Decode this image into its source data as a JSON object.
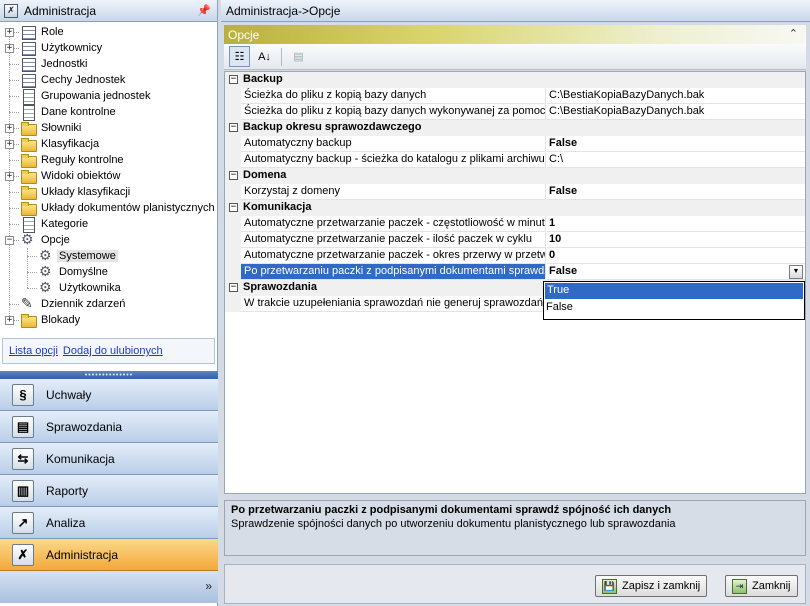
{
  "left_header": {
    "title": "Administracja"
  },
  "tree": [
    {
      "label": "Role",
      "icon": "grid-icon",
      "expander": "+"
    },
    {
      "label": "Użytkownicy",
      "icon": "grid-icon",
      "expander": "+"
    },
    {
      "label": "Jednostki",
      "icon": "grid-icon",
      "expander": ""
    },
    {
      "label": "Cechy Jednostek",
      "icon": "grid-icon",
      "expander": ""
    },
    {
      "label": "Grupowania jednostek",
      "icon": "doc-icon",
      "expander": ""
    },
    {
      "label": "Dane kontrolne",
      "icon": "doc-icon",
      "expander": ""
    },
    {
      "label": "Słowniki",
      "icon": "folder-icon",
      "expander": "+"
    },
    {
      "label": "Klasyfikacja",
      "icon": "folder-icon",
      "expander": "+"
    },
    {
      "label": "Reguły kontrolne",
      "icon": "folder-icon",
      "expander": ""
    },
    {
      "label": "Widoki obiektów",
      "icon": "folder-icon",
      "expander": "+"
    },
    {
      "label": "Układy klasyfikacji",
      "icon": "folder-icon",
      "expander": ""
    },
    {
      "label": "Układy dokumentów planistycznych",
      "icon": "folder-icon",
      "expander": ""
    },
    {
      "label": "Kategorie",
      "icon": "doc-icon",
      "expander": ""
    },
    {
      "label": "Opcje",
      "icon": "gear-icon",
      "expander": "−"
    },
    {
      "label": "Systemowe",
      "icon": "gear-icon",
      "expander": "",
      "child": true,
      "selected": true
    },
    {
      "label": "Domyślne",
      "icon": "gear-icon",
      "expander": "",
      "child": true
    },
    {
      "label": "Użytkownika",
      "icon": "gear-icon",
      "expander": "",
      "child": true
    },
    {
      "label": "Dziennik zdarzeń",
      "icon": "pen-icon",
      "expander": ""
    },
    {
      "label": "Blokady",
      "icon": "folder-icon",
      "expander": "+"
    }
  ],
  "links": {
    "options_list": "Lista opcji",
    "add_favorites": "Dodaj do ulubionych"
  },
  "nav": [
    {
      "label": "Uchwały",
      "icon": "§"
    },
    {
      "label": "Sprawozdania",
      "icon": "▤"
    },
    {
      "label": "Komunikacja",
      "icon": "⇆"
    },
    {
      "label": "Raporty",
      "icon": "▥"
    },
    {
      "label": "Analiza",
      "icon": "↗"
    },
    {
      "label": "Administracja",
      "icon": "✗",
      "active": true
    }
  ],
  "nav_footer": {
    "chevron": "»"
  },
  "breadcrumb": "Administracja->Opcje",
  "panel": {
    "title": "Opcje",
    "collapse": "⌃"
  },
  "toolbar": {
    "categorized": "☷",
    "alphabetical": "A↓",
    "pages": "▤"
  },
  "grid": {
    "categories": [
      {
        "name": "Backup",
        "props": [
          {
            "name": "Ścieżka do pliku z kopią bazy danych",
            "value": "C:\\BestiaKopiaBazyDanych.bak",
            "bold": false
          },
          {
            "name": "Ścieżka do pliku z kopią bazy danych wykonywanej za pomocą",
            "value": "C:\\BestiaKopiaBazyDanych.bak",
            "bold": false
          }
        ]
      },
      {
        "name": "Backup okresu sprawozdawczego",
        "props": [
          {
            "name": "Automatyczny backup",
            "value": "False",
            "bold": true
          },
          {
            "name": "Automatyczny backup - ścieżka do katalogu z plikami archiwum",
            "value": "C:\\",
            "bold": false
          }
        ]
      },
      {
        "name": "Domena",
        "props": [
          {
            "name": "Korzystaj z domeny",
            "value": "False",
            "bold": true
          }
        ]
      },
      {
        "name": "Komunikacja",
        "props": [
          {
            "name": "Automatyczne przetwarzanie paczek - częstotliowość w minutach",
            "value": "1",
            "bold": true
          },
          {
            "name": "Automatyczne przetwarzanie paczek - ilość paczek w cyklu",
            "value": "10",
            "bold": true
          },
          {
            "name": "Automatyczne przetwarzanie paczek - okres przerwy w przetwarzaniu",
            "value": "0",
            "bold": true
          },
          {
            "name": "Po przetwarzaniu paczki z podpisanymi dokumentami sprawdź",
            "value": "False",
            "bold": true,
            "selected": true
          }
        ]
      },
      {
        "name": "Sprawozdania",
        "props": [
          {
            "name": "W trakcie uzupełeniania sprawozdań nie generuj sprawozdań",
            "value": "",
            "bold": false
          }
        ]
      }
    ],
    "dropdown_options": [
      "True",
      "False"
    ]
  },
  "description": {
    "title": "Po przetwarzaniu paczki z podpisanymi dokumentami sprawdź spójność ich danych",
    "text": "Sprawdzenie spójności danych po utworzeniu dokumentu planistycznego lub sprawozdania"
  },
  "footer": {
    "save_close": "Zapisz i zamknij",
    "close": "Zamknij"
  }
}
